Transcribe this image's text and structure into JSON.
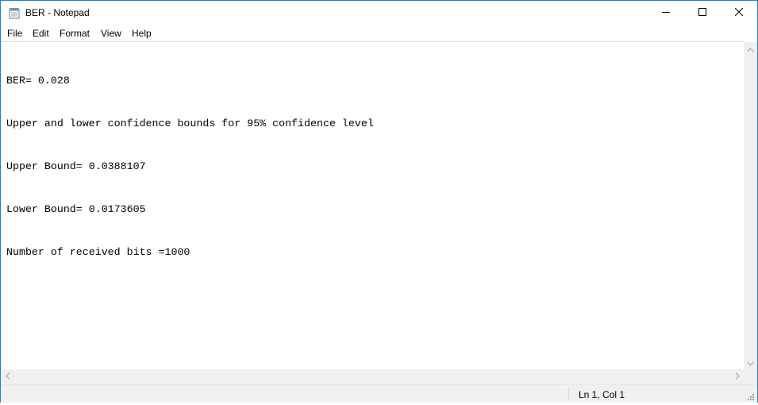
{
  "window": {
    "title": "BER - Notepad"
  },
  "menu": {
    "items": [
      "File",
      "Edit",
      "Format",
      "View",
      "Help"
    ]
  },
  "document": {
    "lines": [
      "BER= 0.028",
      "Upper and lower confidence bounds for 95% confidence level",
      "Upper Bound= 0.0388107",
      "Lower Bound= 0.0173605",
      "Number of received bits =1000"
    ]
  },
  "status": {
    "position": "Ln 1, Col 1"
  },
  "icons": {
    "app": "notepad-icon",
    "minimize": "minimize-icon",
    "maximize": "maximize-icon",
    "close": "close-icon"
  },
  "colors": {
    "window_border": "#1883d7",
    "chrome_bg": "#f0f0f0"
  }
}
